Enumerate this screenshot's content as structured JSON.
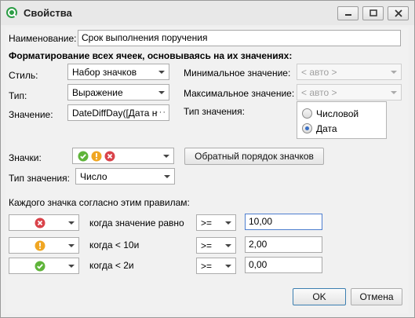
{
  "window": {
    "title": "Свойства"
  },
  "name_field": {
    "label": "Наименование:",
    "value": "Срок выполнения поручения"
  },
  "section_title": "Форматирование всех ячеек, основываясь на их значениях:",
  "style": {
    "label": "Стиль:",
    "value": "Набор значков"
  },
  "type": {
    "label": "Тип:",
    "value": "Выражение"
  },
  "value_field": {
    "label": "Значение:",
    "value": "DateDiffDay([Дата н",
    "button": "···"
  },
  "min_value": {
    "label": "Минимальное значение:",
    "placeholder": "< авто >"
  },
  "max_value": {
    "label": "Максимальное значение:",
    "placeholder": "< авто >"
  },
  "value_type": {
    "label": "Тип значения:",
    "options": [
      "Числовой",
      "Дата"
    ],
    "selected": "Дата"
  },
  "icons": {
    "label": "Значки:",
    "set": [
      "check-icon",
      "warning-icon",
      "error-icon"
    ],
    "reverse_button": "Обратный порядок значков"
  },
  "icon_value_type": {
    "label": "Тип значения:",
    "value": "Число"
  },
  "rules": {
    "title": "Каждого значка согласно этим правилам:",
    "rows": [
      {
        "icon": "error-icon",
        "condition": "когда значение равно",
        "operator": ">=",
        "value": "10,00"
      },
      {
        "icon": "warning-icon",
        "condition": "когда < 10и",
        "operator": ">=",
        "value": "2,00"
      },
      {
        "icon": "check-icon",
        "condition": "когда < 2и",
        "operator": ">=",
        "value": "0,00"
      }
    ]
  },
  "footer": {
    "ok": "OK",
    "cancel": "Отмена"
  },
  "colors": {
    "accent": "#4d7ecf",
    "error": "#d9434a",
    "warning": "#f0a623",
    "check": "#5fb43a"
  }
}
